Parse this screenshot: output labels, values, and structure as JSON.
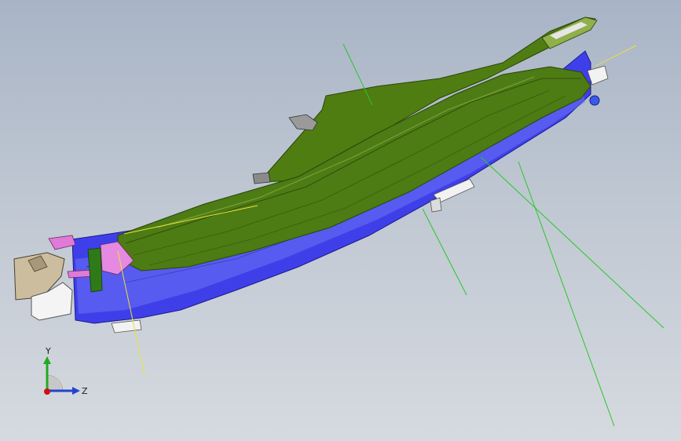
{
  "colors": {
    "background_top": "#a8b4c6",
    "background_bottom": "#d6dae0",
    "cover_green": "#4f7e12",
    "cover_green_light": "#6a9a1e",
    "cover_green_dark": "#3c6110",
    "body_blue": "#3a3ae8",
    "body_blue_light": "#6e74f0",
    "accent_pink": "#e07ad8",
    "clip_white": "#f2f2f2",
    "bracket_tan": "#c8b89a",
    "ref_line_green": "#28c828",
    "ref_line_yellow": "#e8e23c",
    "axis_x": "#cc1111",
    "axis_y": "#22aa22",
    "axis_z": "#2244cc"
  },
  "triad": {
    "y_label": "Y",
    "z_label": "Z"
  }
}
